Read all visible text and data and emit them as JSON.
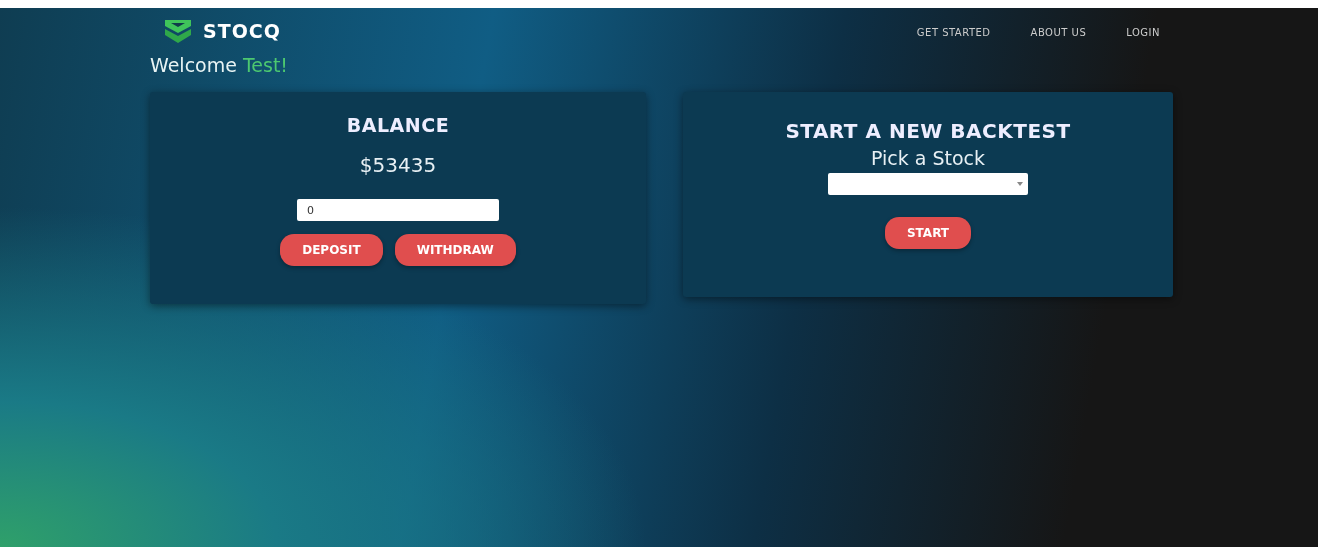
{
  "brand": {
    "name": "STOCQ"
  },
  "nav": [
    {
      "label": "GET STARTED"
    },
    {
      "label": "ABOUT US"
    },
    {
      "label": "LOGIN"
    }
  ],
  "welcome": {
    "text": "Welcome ",
    "user": "Test!"
  },
  "balance_card": {
    "title": "BALANCE",
    "amount": "$53435",
    "amount_field": {
      "value": "0"
    },
    "buttons": [
      {
        "label": "DEPOSIT"
      },
      {
        "label": "WITHDRAW"
      }
    ]
  },
  "backtest_card": {
    "title": "START A NEW BACKTEST",
    "subtitle": "Pick a Stock",
    "button": {
      "label": "START"
    }
  }
}
